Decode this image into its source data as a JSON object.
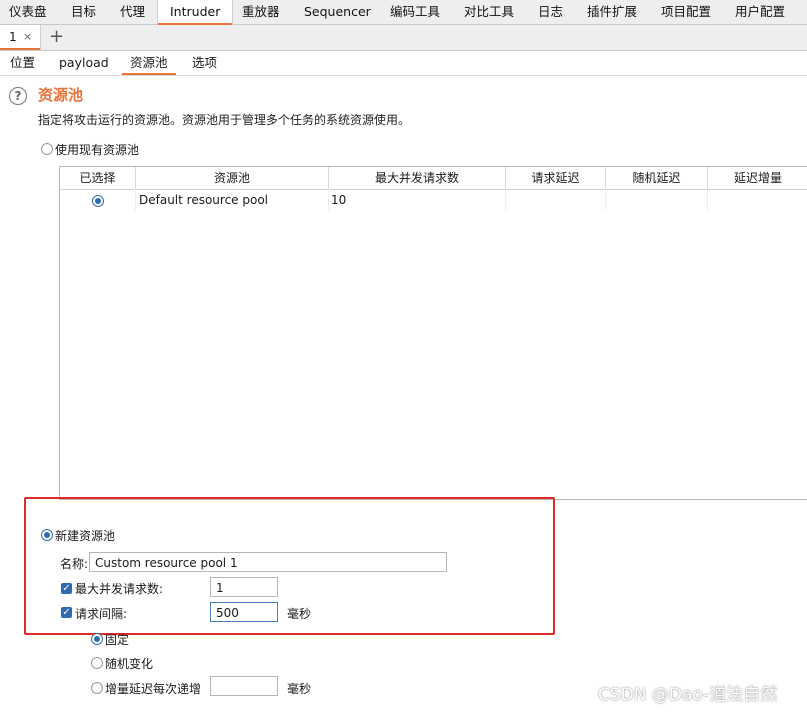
{
  "menubar": {
    "items": [
      "仪表盘",
      "目标",
      "代理",
      "Intruder",
      "重放器",
      "Sequencer",
      "编码工具",
      "对比工具",
      "日志",
      "插件扩展",
      "项目配置",
      "用户配置"
    ],
    "active": "Intruder"
  },
  "tabs": {
    "tab1_label": "1",
    "tab1_close": "×",
    "add_label": "+"
  },
  "subtabs": [
    "位置",
    "payload",
    "资源池",
    "选项"
  ],
  "section": {
    "title": "资源池",
    "description": "指定将攻击运行的资源池。资源池用于管理多个任务的系统资源使用。"
  },
  "use_existing_label": "使用现有资源池",
  "table": {
    "columns": [
      "已选择",
      "资源池",
      "最大并发请求数",
      "请求延迟",
      "随机延迟",
      "延迟增量"
    ],
    "rows": [
      {
        "selected": true,
        "pool": "Default resource pool",
        "max_concurrent": "10",
        "request_delay": "",
        "random_delay": "",
        "delay_increment": ""
      }
    ]
  },
  "new_pool": {
    "label": "新建资源池",
    "name_label": "名称:",
    "name_value": "Custom resource pool 1",
    "max_concurrent_label": "最大并发请求数:",
    "max_concurrent_value": "1",
    "request_delay_label": "请求间隔:",
    "request_delay_value": "500",
    "unit_ms": "毫秒",
    "fixed_label": "固定",
    "random_label": "随机变化",
    "increment_label": "增量延迟每次递增",
    "increment_unit": "毫秒"
  },
  "watermark": "CSDN @Dao-道法自然"
}
